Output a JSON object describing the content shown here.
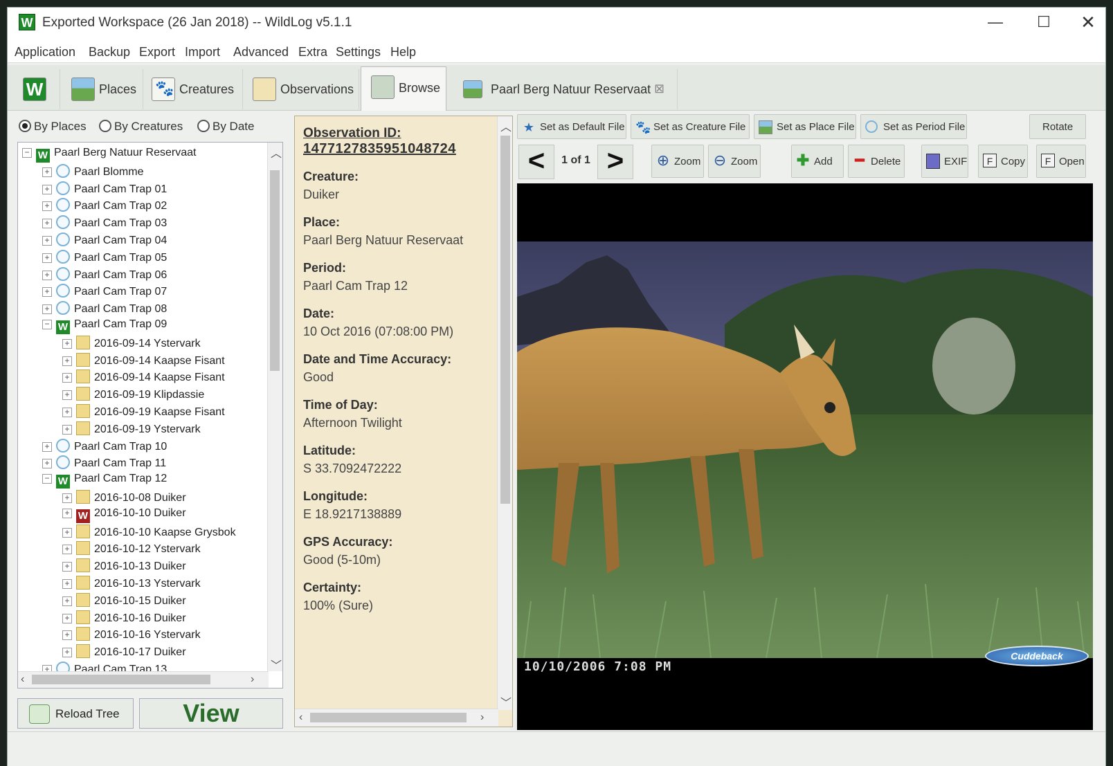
{
  "window": {
    "logo": "W",
    "title": "Exported Workspace (26 Jan 2018) -- WildLog v5.1.1",
    "minimize": "—",
    "maximize": "☐",
    "close": "✕"
  },
  "menu": [
    "Application",
    "Backup",
    "Export",
    "Import",
    "Advanced",
    "Extra",
    "Settings",
    "Help"
  ],
  "tabs": {
    "home": "W",
    "places": "Places",
    "creatures": "Creatures",
    "observations": "Observations",
    "browse": "Browse",
    "place_tab": "Paarl Berg Natuur Reservaat",
    "place_tab_close": "⊠"
  },
  "browse_modes": {
    "by_places": "By Places",
    "by_creatures": "By Creatures",
    "by_date": "By Date",
    "selected": "By Places"
  },
  "tree": [
    {
      "label": "Paarl Berg Natuur Reservaat",
      "icon": "wildlog-icon",
      "exp": "−"
    },
    {
      "label": "Paarl Blomme",
      "icon": "period-icon",
      "exp": "+"
    },
    {
      "label": "Paarl Cam Trap 01",
      "icon": "period-icon",
      "exp": "+"
    },
    {
      "label": "Paarl Cam Trap 02",
      "icon": "period-icon",
      "exp": "+"
    },
    {
      "label": "Paarl Cam Trap 03",
      "icon": "period-icon",
      "exp": "+"
    },
    {
      "label": "Paarl Cam Trap 04",
      "icon": "period-icon",
      "exp": "+"
    },
    {
      "label": "Paarl Cam Trap 05",
      "icon": "period-icon",
      "exp": "+"
    },
    {
      "label": "Paarl Cam Trap 06",
      "icon": "period-icon",
      "exp": "+"
    },
    {
      "label": "Paarl Cam Trap 07",
      "icon": "period-icon",
      "exp": "+"
    },
    {
      "label": "Paarl Cam Trap 08",
      "icon": "period-icon",
      "exp": "+"
    },
    {
      "label": "Paarl Cam Trap 09",
      "icon": "wildlog-icon",
      "exp": "−"
    },
    {
      "label": "2016-09-14 Ystervark",
      "icon": "observation-icon",
      "exp": "+"
    },
    {
      "label": "2016-09-14 Kaapse Fisant",
      "icon": "observation-icon",
      "exp": "+"
    },
    {
      "label": "2016-09-14 Kaapse Fisant",
      "icon": "observation-icon",
      "exp": "+"
    },
    {
      "label": "2016-09-19 Klipdassie",
      "icon": "observation-icon",
      "exp": "+"
    },
    {
      "label": "2016-09-19 Kaapse Fisant",
      "icon": "observation-icon",
      "exp": "+"
    },
    {
      "label": "2016-09-19 Ystervark",
      "icon": "observation-icon",
      "exp": "+"
    },
    {
      "label": "Paarl Cam Trap 10",
      "icon": "period-icon",
      "exp": "+"
    },
    {
      "label": "Paarl Cam Trap 11",
      "icon": "period-icon",
      "exp": "+"
    },
    {
      "label": "Paarl Cam Trap 12",
      "icon": "wildlog-icon",
      "exp": "−"
    },
    {
      "label": "2016-10-08 Duiker",
      "icon": "observation-icon",
      "exp": "+"
    },
    {
      "label": "2016-10-10 Duiker",
      "icon": "selected-observation-icon",
      "exp": "+"
    },
    {
      "label": "2016-10-10 Kaapse Grysbok",
      "icon": "observation-icon",
      "exp": "+"
    },
    {
      "label": "2016-10-12 Ystervark",
      "icon": "observation-icon",
      "exp": "+"
    },
    {
      "label": "2016-10-13 Duiker",
      "icon": "observation-icon",
      "exp": "+"
    },
    {
      "label": "2016-10-13 Ystervark",
      "icon": "observation-icon",
      "exp": "+"
    },
    {
      "label": "2016-10-15 Duiker",
      "icon": "observation-icon",
      "exp": "+"
    },
    {
      "label": "2016-10-16 Duiker",
      "icon": "observation-icon",
      "exp": "+"
    },
    {
      "label": "2016-10-16 Ystervark",
      "icon": "observation-icon",
      "exp": "+"
    },
    {
      "label": "2016-10-17 Duiker",
      "icon": "observation-icon",
      "exp": "+"
    },
    {
      "label": "Paarl Cam Trap 13",
      "icon": "period-icon",
      "exp": "+"
    }
  ],
  "left_actions": {
    "reload": "Reload Tree",
    "view": "View"
  },
  "details": {
    "id_label": "Observation ID:",
    "id_value": "1477127835951048724",
    "fields": [
      {
        "label": "Creature:",
        "value": "Duiker"
      },
      {
        "label": "Place:",
        "value": "Paarl Berg Natuur Reservaat"
      },
      {
        "label": "Period:",
        "value": "Paarl Cam Trap 12"
      },
      {
        "label": "Date:",
        "value": "10 Oct 2016 (07:08:00 PM)"
      },
      {
        "label": "Date and Time Accuracy:",
        "value": "Good"
      },
      {
        "label": "Time of Day:",
        "value": "Afternoon Twilight"
      },
      {
        "label": "Latitude:",
        "value": "S 33.7092472222"
      },
      {
        "label": "Longitude:",
        "value": "E 18.9217138889"
      },
      {
        "label": "GPS Accuracy:",
        "value": "Good (5-10m)"
      },
      {
        "label": "Certainty:",
        "value": "100% (Sure)"
      }
    ]
  },
  "toolbar": {
    "set_default": "Set as Default File",
    "set_creature": "Set as Creature File",
    "set_place": "Set as Place File",
    "set_period": "Set as Period File",
    "rotate": "Rotate",
    "prev": "<",
    "counter": "1 of 1",
    "next": ">",
    "zoom_in": "Zoom",
    "zoom_out": "Zoom",
    "add": "Add",
    "delete": "Delete",
    "exif": "EXIF",
    "copy": "Copy",
    "open": "Open"
  },
  "image": {
    "timestamp": "10/10/2006   7:08 PM",
    "brand": "Cuddeback"
  },
  "colors": {
    "details_bg": "#f2e9cf",
    "view_text": "#2a6d2a",
    "wildlog_green": "#1f8a2a"
  }
}
